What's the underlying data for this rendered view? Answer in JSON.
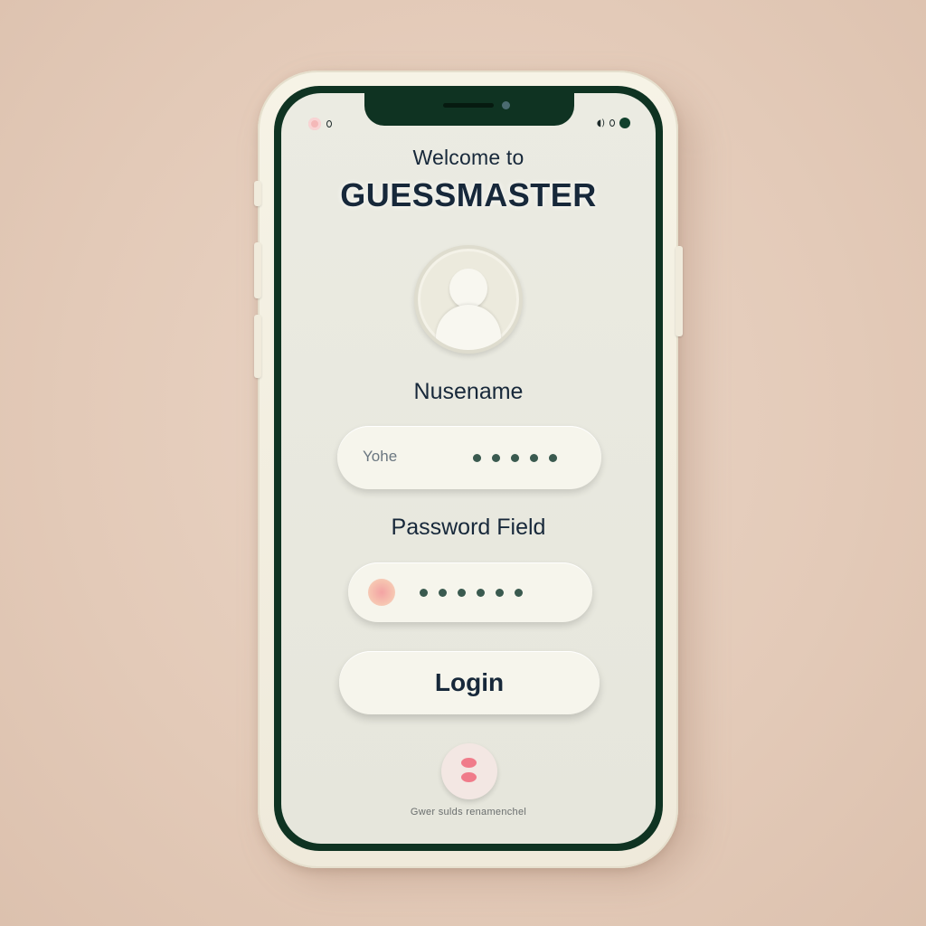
{
  "header": {
    "welcome_text": "Welcome to",
    "app_title": "GUESSMASTER"
  },
  "form": {
    "username_label": "Nusename",
    "username_value": "Yohe",
    "password_label": "Password Field",
    "login_label": "Login"
  },
  "footer": {
    "text": "Gwer sulds renamenchel"
  },
  "icons": {
    "avatar": "user-avatar-icon",
    "password_key": "key-icon",
    "bottom": "emoji-icon",
    "status_left": "record-icon",
    "status_right": "battery-icon"
  },
  "colors": {
    "bezel": "#0f3322",
    "text": "#17283a",
    "screen": "#ebebe2",
    "accent_pink": "#f07b8a"
  }
}
